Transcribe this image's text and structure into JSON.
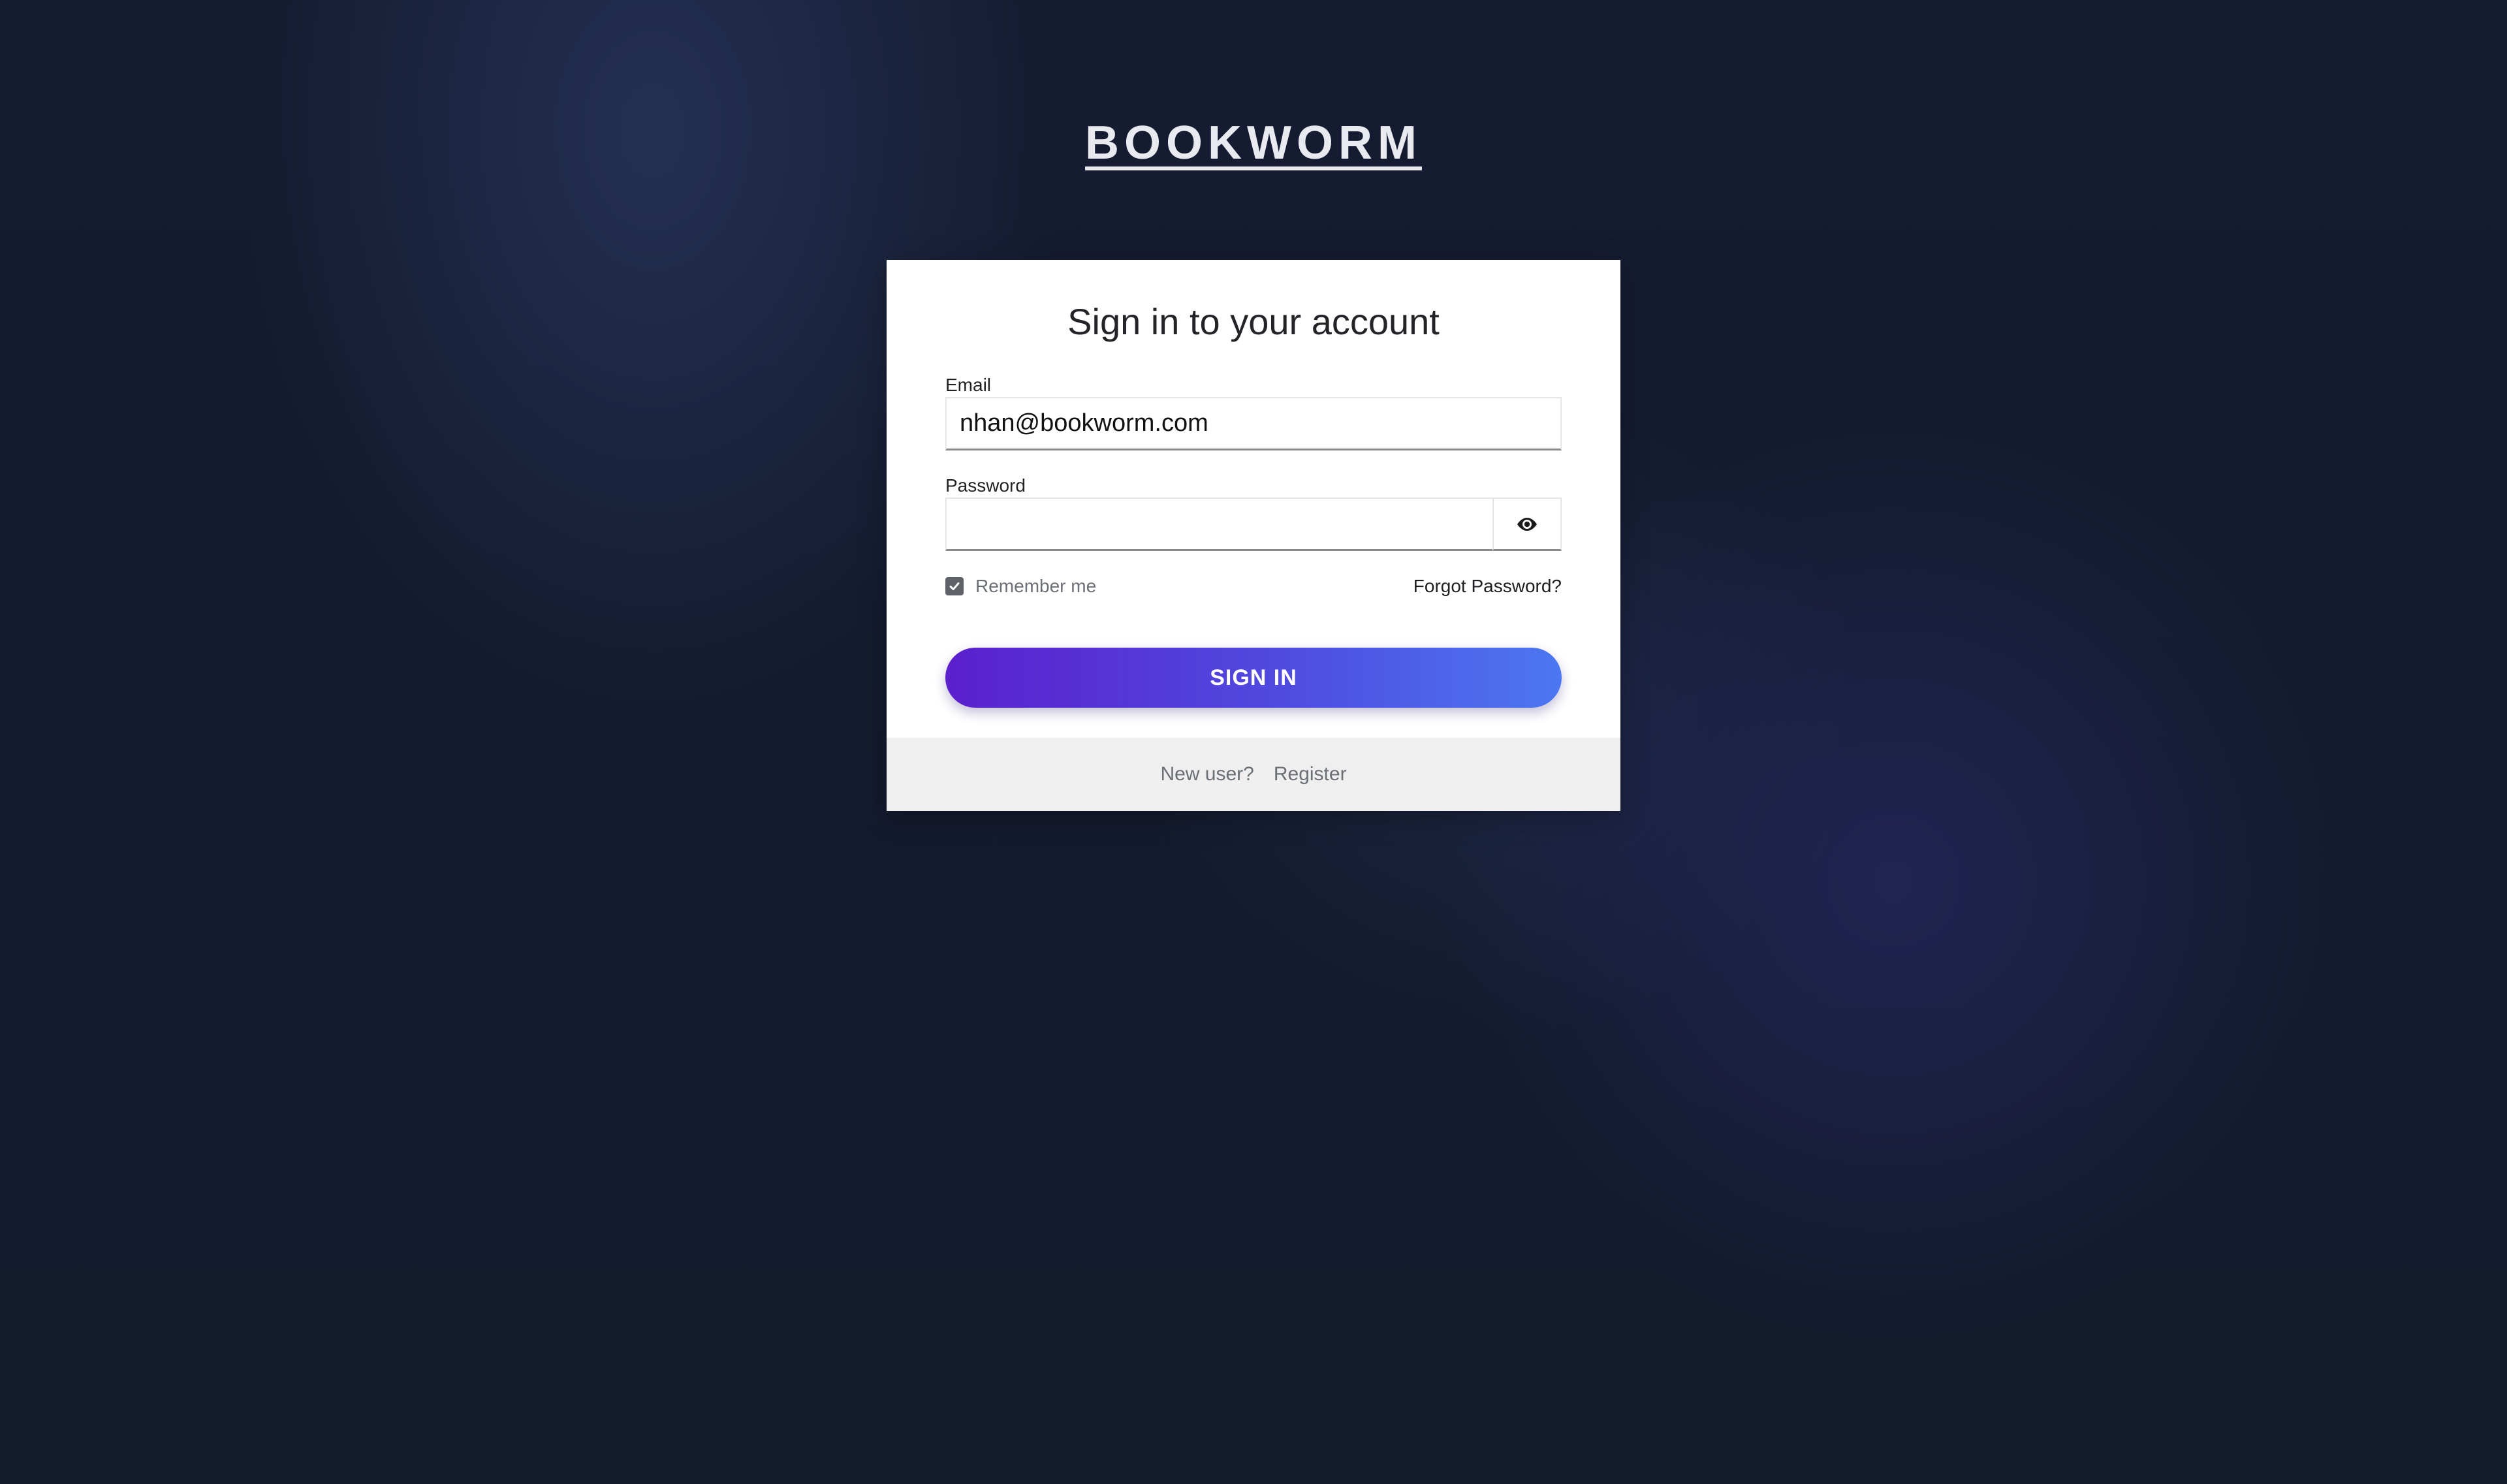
{
  "brand": {
    "name": "BOOKWORM"
  },
  "signin_card": {
    "title": "Sign in to your account",
    "email": {
      "label": "Email",
      "value": "nhan@bookworm.com"
    },
    "password": {
      "label": "Password",
      "value": "",
      "toggle_icon": "eye-icon"
    },
    "remember_me": {
      "label": "Remember me",
      "checked": true
    },
    "forgot_password_label": "Forgot Password?",
    "submit_label": "SIGN IN",
    "footer": {
      "prompt": "New user?",
      "register_label": "Register"
    }
  },
  "colors": {
    "background": "#141a2e",
    "button_gradient_start": "#5b1fcc",
    "button_gradient_end": "#4c77f2",
    "footer_bg": "#efefef"
  }
}
